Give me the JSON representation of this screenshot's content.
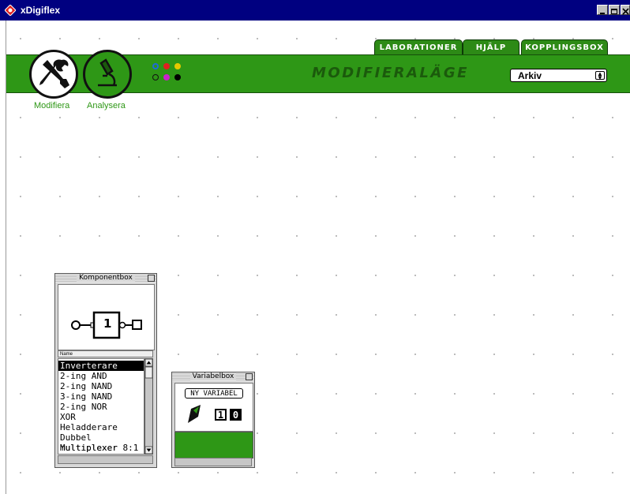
{
  "window": {
    "title": "xDigiflex"
  },
  "tabs": [
    {
      "label": "LABORATIONER"
    },
    {
      "label": "HJÄLP"
    },
    {
      "label": "KOPPLINGSBOX"
    }
  ],
  "toolbar": {
    "mode_title": "MODIFIERALÄGE",
    "modify_label": "Modifiera",
    "analyze_label": "Analysera",
    "archive_select": "Arkiv",
    "color_dots": [
      "#1e6bd6",
      "#e02020",
      "#e6c800",
      "#2e9716",
      "#cc22cc",
      "#000000"
    ],
    "icons": {
      "modify": "tools-icon",
      "analyze": "microscope-icon"
    }
  },
  "component_box": {
    "title": "Komponentbox",
    "preview_value": "1",
    "list_header": "Name",
    "items": [
      "Inverterare",
      "2-ing AND",
      "2-ing NAND",
      "3-ing NAND",
      "2-ing NOR",
      "XOR",
      "Heladderare",
      "Dubbel multiplexer",
      "Multiplexer 8:1"
    ],
    "selected_index": 0
  },
  "variable_box": {
    "title": "Variabelbox",
    "new_button": "NY VARIABEL",
    "bit_one": "1",
    "bit_zero": "0"
  }
}
